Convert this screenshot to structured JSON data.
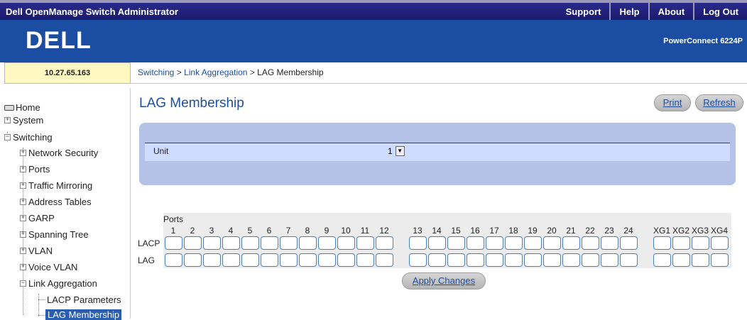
{
  "app": {
    "title": "Dell OpenManage Switch Administrator",
    "nav": [
      "Support",
      "Help",
      "About",
      "Log Out"
    ]
  },
  "brand": {
    "logo": "DELL",
    "model": "PowerConnect 6224P"
  },
  "ip": "10.27.65.163",
  "breadcrumb": {
    "part1": "Switching",
    "sep": ">",
    "part2": "Link Aggregation",
    "current": "LAG Membership"
  },
  "sidebar": {
    "home": "Home",
    "system": "System",
    "switching": "Switching",
    "network_security": "Network Security",
    "ports": "Ports",
    "traffic_mirroring": "Traffic Mirroring",
    "address_tables": "Address Tables",
    "garp": "GARP",
    "spanning_tree": "Spanning Tree",
    "vlan": "VLAN",
    "voice_vlan": "Voice VLAN",
    "link_aggregation": "Link Aggregation",
    "lacp_parameters": "LACP Parameters",
    "lag_membership": "LAG Membership",
    "plus": "+",
    "minus": "−"
  },
  "main": {
    "title": "LAG Membership",
    "print": "Print",
    "refresh": "Refresh",
    "unit_label": "Unit",
    "unit_value": "1",
    "ports_label": "Ports",
    "lacp_label": "LACP",
    "lag_label": "LAG",
    "port_numbers": [
      "1",
      "2",
      "3",
      "4",
      "5",
      "6",
      "7",
      "8",
      "9",
      "10",
      "11",
      "12",
      "13",
      "14",
      "15",
      "16",
      "17",
      "18",
      "19",
      "20",
      "21",
      "22",
      "23",
      "24",
      "XG1",
      "XG2",
      "XG3",
      "XG4"
    ],
    "apply": "Apply Changes"
  },
  "colors": {
    "topbar": "#1a1a6e",
    "brandbar": "#1b4ea2",
    "link": "#1d4fa0",
    "panel": "#b3c2e6"
  }
}
